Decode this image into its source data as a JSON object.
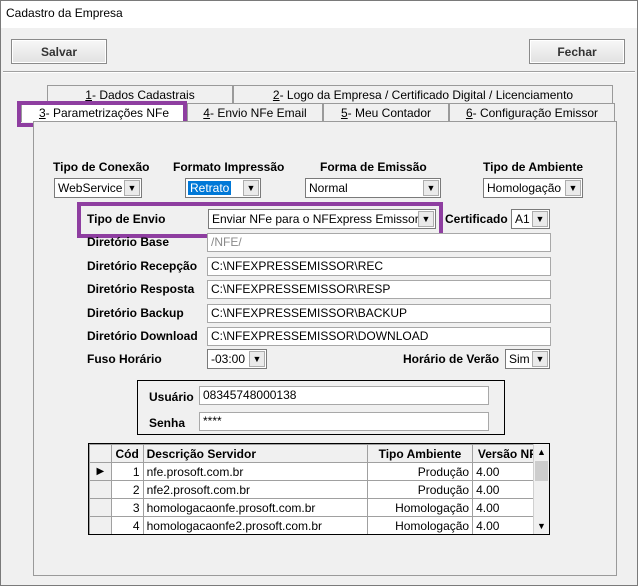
{
  "window": {
    "title": "Cadastro da Empresa"
  },
  "toolbar": {
    "save_label": "Salvar",
    "close_label": "Fechar"
  },
  "tabs": [
    {
      "prefix": "1",
      "label": " - Dados Cadastrais"
    },
    {
      "prefix": "2",
      "label": " - Logo da Empresa / Certificado Digital / Licenciamento"
    },
    {
      "prefix": "3",
      "label": " - Parametrizações NFe"
    },
    {
      "prefix": "4",
      "label": " - Envio NFe Email"
    },
    {
      "prefix": "5",
      "label": " - Meu Contador"
    },
    {
      "prefix": "6",
      "label": " - Configuração Emissor"
    }
  ],
  "settings": {
    "tipo_conexao": {
      "label": "Tipo de Conexão",
      "value": "WebService"
    },
    "formato_impressao": {
      "label": "Formato Impressão",
      "value": "Retrato"
    },
    "forma_emissao": {
      "label": "Forma de Emissão",
      "value": "Normal"
    },
    "tipo_ambiente": {
      "label": "Tipo de Ambiente",
      "value": "Homologação"
    }
  },
  "envio": {
    "tipo_envio": {
      "label": "Tipo de Envio",
      "value": "Enviar NFe para o NFExpress Emissor"
    },
    "certificado": {
      "label": "Certificado",
      "value": "A1"
    },
    "diretorio_base": {
      "label": "Diretório Base",
      "value": "/NFE/"
    },
    "diretorio_recepcao": {
      "label": "Diretório Recepção",
      "value": "C:\\NFEXPRESSEMISSOR\\REC"
    },
    "diretorio_resposta": {
      "label": "Diretório Resposta",
      "value": "C:\\NFEXPRESSEMISSOR\\RESP"
    },
    "diretorio_backup": {
      "label": "Diretório Backup",
      "value": "C:\\NFEXPRESSEMISSOR\\BACKUP"
    },
    "diretorio_download": {
      "label": "Diretório Download",
      "value": "C:\\NFEXPRESSEMISSOR\\DOWNLOAD"
    },
    "fuso_horario": {
      "label": "Fuso Horário",
      "value": "-03:00"
    },
    "horario_verao": {
      "label": "Horário de Verão",
      "value": "Sim"
    }
  },
  "credentials": {
    "usuario": {
      "label": "Usuário",
      "value": "08345748000138"
    },
    "senha": {
      "label": "Senha",
      "value": "****"
    }
  },
  "servers": {
    "headers": {
      "cod": "Cód",
      "descricao": "Descrição Servidor",
      "ambiente": "Tipo Ambiente",
      "versao": "Versão NFe"
    },
    "current_marker": "▶",
    "rows": [
      {
        "cod": "1",
        "descricao": "nfe.prosoft.com.br",
        "ambiente": "Produção",
        "versao": "4.00"
      },
      {
        "cod": "2",
        "descricao": "nfe2.prosoft.com.br",
        "ambiente": "Produção",
        "versao": "4.00"
      },
      {
        "cod": "3",
        "descricao": "homologacaonfe.prosoft.com.br",
        "ambiente": "Homologação",
        "versao": "4.00"
      },
      {
        "cod": "4",
        "descricao": "homologacaonfe2.prosoft.com.br",
        "ambiente": "Homologação",
        "versao": "4.00"
      }
    ]
  },
  "icons": {
    "dropdown": "chevron-down-icon",
    "scroll_up": "arrow-up-icon",
    "scroll_down": "arrow-down-icon"
  },
  "colors": {
    "highlight": "#8e3ea0",
    "selection": "#0078d7"
  }
}
